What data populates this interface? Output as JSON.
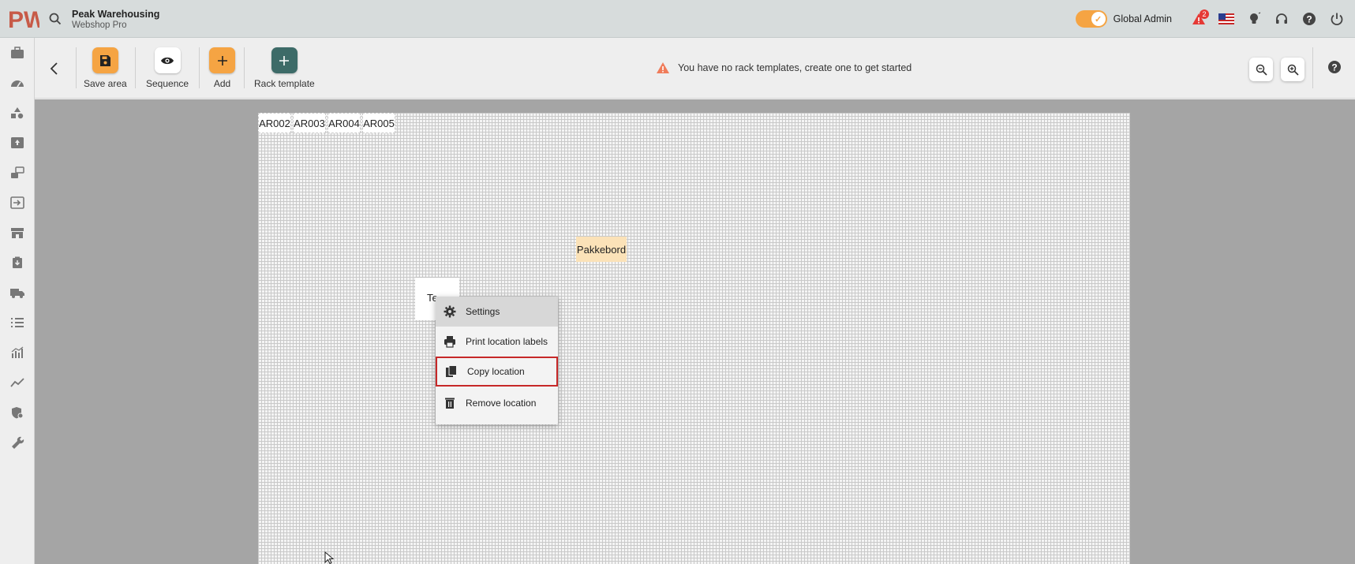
{
  "app": {
    "logo_text": "PW",
    "company_name": "Peak Warehousing",
    "company_sub": "Webshop Pro"
  },
  "header": {
    "admin_label": "Global Admin",
    "notification_count": "2",
    "toggle_on": true
  },
  "sidebar": {
    "items": [
      "briefcase-icon",
      "speedometer-icon",
      "shapes-icon",
      "inbox-upload-icon",
      "swap-icon",
      "import-icon",
      "warehouse-icon",
      "clipboard-download-icon",
      "truck-icon",
      "list-numbered-icon",
      "chart-bars-icon",
      "trend-line-icon",
      "shield-icon",
      "wrench-icon"
    ]
  },
  "toolbar": {
    "save_label": "Save area",
    "sequence_label": "Sequence",
    "add_label": "Add",
    "rack_template_label": "Rack template",
    "warning_text": "You have no rack templates, create one to get started"
  },
  "canvas": {
    "locations": [
      "AR002",
      "AR003",
      "AR004",
      "AR005"
    ],
    "pack_label": "Pakkebord",
    "te_label": "Te"
  },
  "context_menu": {
    "settings": "Settings",
    "print_labels": "Print location labels",
    "copy_location": "Copy location",
    "remove_location": "Remove location"
  },
  "colors": {
    "accent_orange": "#f5a443",
    "teal": "#3d6b68",
    "warning": "#f07c5a",
    "selection_red": "#c62828"
  }
}
